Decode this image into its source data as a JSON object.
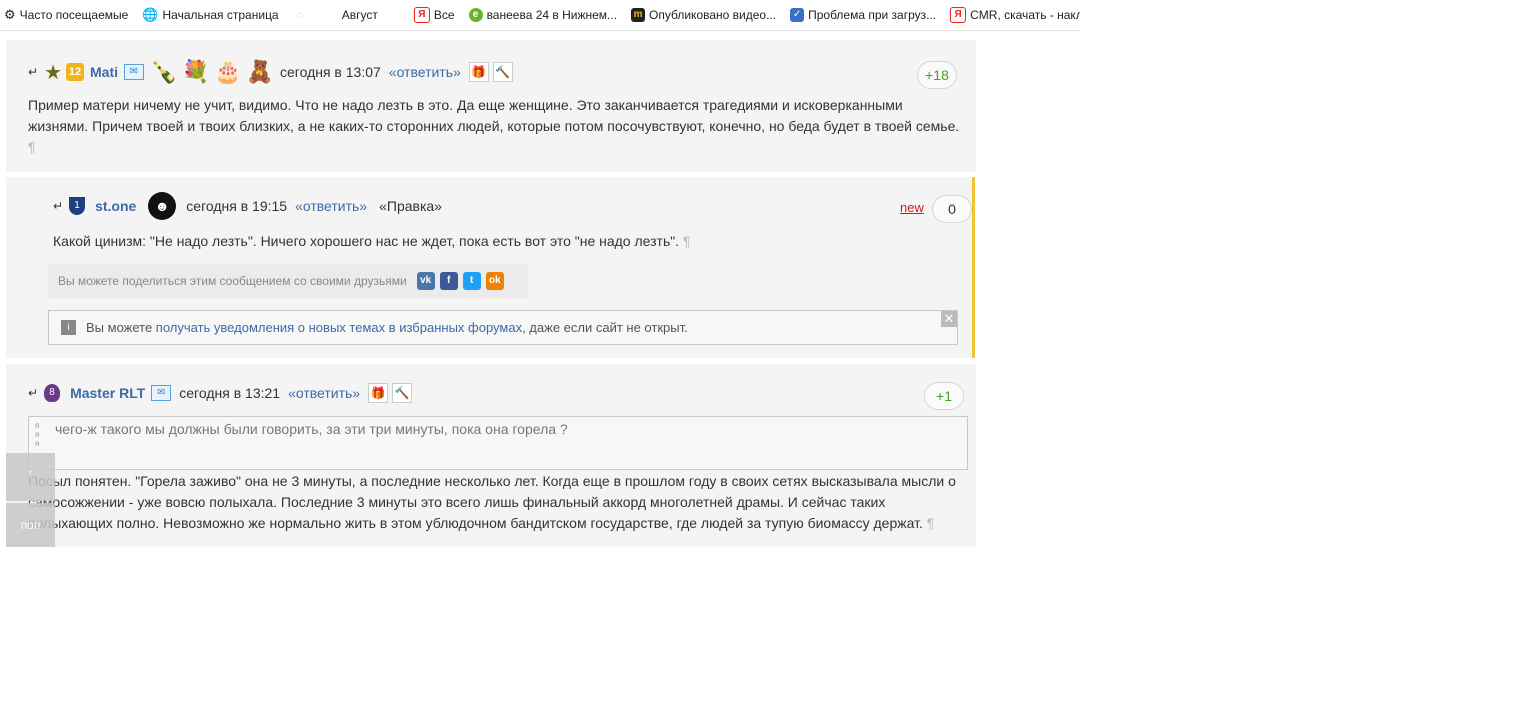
{
  "bookmarks": [
    {
      "label": "Часто посещаемые",
      "icon": "gear-icon"
    },
    {
      "label": "Начальная страница",
      "icon": "globe-icon"
    },
    {
      "label": "Август",
      "icon": "spinner-icon"
    },
    {
      "label": "Все",
      "icon": "yandex-icon"
    },
    {
      "label": "ванеева 24 в Нижнем...",
      "icon": "green-leaf-icon"
    },
    {
      "label": "Опубликовано видео...",
      "icon": "m-icon"
    },
    {
      "label": "Проблема при загруз...",
      "icon": "page-icon"
    },
    {
      "label": "CMR, скачать - накла...",
      "icon": "yandex-icon"
    }
  ],
  "comments": [
    {
      "author": "Mati",
      "rank_badge": "12",
      "time": "сегодня в 13:07",
      "reply": "«ответить»",
      "vote": "+18",
      "text": "Пример матери ничему не учит, видимо. Что не надо лезть в это. Да еще женщине. Это заканчивается трагедиями и исковерканными жизнями. Причем твоей и твоих близких, а не каких-то сторонних людей, которые потом посочувствуют, конечно, но беда будет в твоей семье.",
      "gifts": [
        "bottle-gift-icon",
        "flowers-gift-icon",
        "cake-gift-icon",
        "teddy-bear-gift-icon"
      ]
    },
    {
      "author": "st.one",
      "rank_badge": "1",
      "time": "сегодня в 19:15",
      "reply": "«ответить»",
      "edit": "«Правка»",
      "new_label": "new",
      "vote": "0",
      "text": "Какой цинизм: \"Не надо лезть\". Ничего хорошего нас не ждет, пока есть вот это \"не надо лезть\".",
      "share_label": "Вы можете поделиться этим сообщением со своими друзьями",
      "notice_prefix": "Вы можете ",
      "notice_link": "получать уведомления о новых темах в избранных форумах",
      "notice_suffix": ", даже если сайт не открыт."
    },
    {
      "author": "Master RLT",
      "rank_badge": "8",
      "time": "сегодня в 13:21",
      "reply": "«ответить»",
      "vote": "+1",
      "quote": "чего-ж такого мы должны были говорить, за эти три минуты, пока она горела ?",
      "text": "Посыл понятен. \"Горела заживо\" она не 3 минуты, а последние несколько лет. Когда еще в прошлом году в своих сетях высказывала мысли о самосожжении - уже вовсю полыхала. Последние 3 минуты это всего лишь финальный аккорд многолетней драмы. И сейчас таких полыхающих полно. Невозможно же нормально жить в этом ублюдочном бандитском государстве, где людей за тупую биомассу держат."
    }
  ],
  "pilcrow": "¶",
  "side_buttons": [
    "↑",
    "поп"
  ],
  "colors": {
    "link": "#3d6aa8",
    "vote_green": "#46a01e",
    "new_red": "#d21c1c",
    "highlight_border": "#f4c430",
    "comment_bg": "#f4f4f4"
  }
}
